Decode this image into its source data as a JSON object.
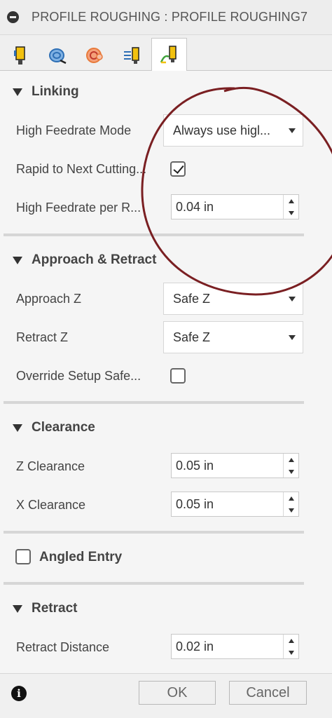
{
  "title": "PROFILE ROUGHING : PROFILE ROUGHING7",
  "tabs": [
    {
      "icon": "tool-icon"
    },
    {
      "icon": "geometry-icon"
    },
    {
      "icon": "heights-icon"
    },
    {
      "icon": "passes-icon"
    },
    {
      "icon": "linking-icon",
      "active": true
    }
  ],
  "linking": {
    "header": "Linking",
    "high_feedrate_mode_label": "High Feedrate Mode",
    "high_feedrate_mode_value": "Always use higl...",
    "rapid_label": "Rapid to Next Cutting...",
    "rapid_checked": true,
    "high_feedrate_per_label": "High Feedrate per R...",
    "high_feedrate_per_value": "0.04 in"
  },
  "approach": {
    "header": "Approach & Retract",
    "approach_z_label": "Approach Z",
    "approach_z_value": "Safe Z",
    "retract_z_label": "Retract Z",
    "retract_z_value": "Safe Z",
    "override_label": "Override Setup Safe...",
    "override_checked": false
  },
  "clearance": {
    "header": "Clearance",
    "z_label": "Z Clearance",
    "z_value": "0.05 in",
    "x_label": "X Clearance",
    "x_value": "0.05 in"
  },
  "angled_entry": {
    "label": "Angled Entry",
    "checked": false
  },
  "retract": {
    "header": "Retract",
    "distance_label": "Retract Distance",
    "distance_value": "0.02 in"
  },
  "footer": {
    "info_glyph": "i",
    "ok_label": "OK",
    "cancel_label": "Cancel"
  },
  "colors": {
    "annotation": "#7a1f22",
    "tool_yellow": "#f2c10f",
    "tool_blue": "#2e6fb5",
    "tool_orange": "#e87a3a",
    "tool_green": "#3fa23a"
  }
}
